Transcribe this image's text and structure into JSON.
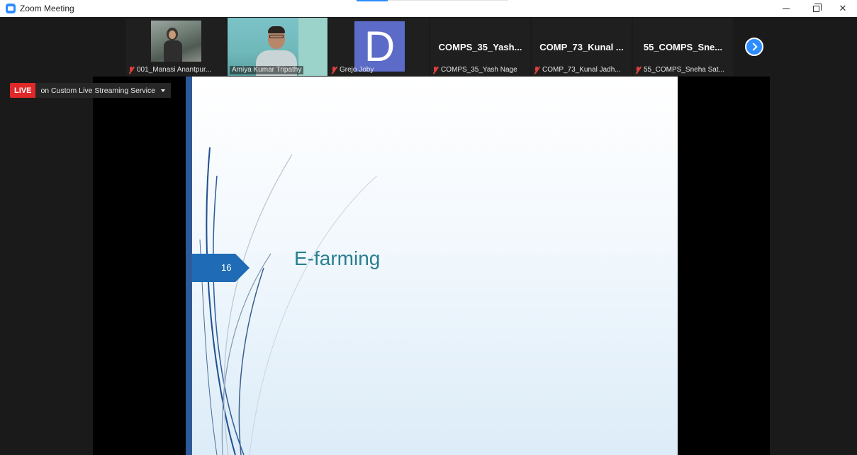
{
  "window": {
    "title": "Zoom Meeting"
  },
  "gallery": {
    "tiles": [
      {
        "name": "001_Manasi Anantpur...",
        "muted": true,
        "type": "photo"
      },
      {
        "name": "Amiya Kumar Tripathy",
        "muted": false,
        "type": "video",
        "active": true
      },
      {
        "name": "Grejo Joby",
        "muted": true,
        "type": "avatar",
        "avatar_letter": "D",
        "avatar_color": "#5b6bc7"
      },
      {
        "name": "COMPS_35_Yash Nage",
        "display_name": "COMPS_35_Yash...",
        "muted": true,
        "type": "name"
      },
      {
        "name": "COMP_73_Kunal Jadh...",
        "display_name": "COMP_73_Kunal ...",
        "muted": true,
        "type": "name"
      },
      {
        "name": "55_COMPS_Sneha Sat...",
        "display_name": "55_COMPS_Sne...",
        "muted": true,
        "type": "name"
      }
    ],
    "next_icon": "chevron-right-icon"
  },
  "live": {
    "badge": "LIVE",
    "service": "on Custom Live Streaming Service",
    "badge_color": "#e02828"
  },
  "slide": {
    "number": "16",
    "title": "E-farming",
    "accent_color": "#2d5b9a",
    "title_color": "#2a7f8f"
  }
}
